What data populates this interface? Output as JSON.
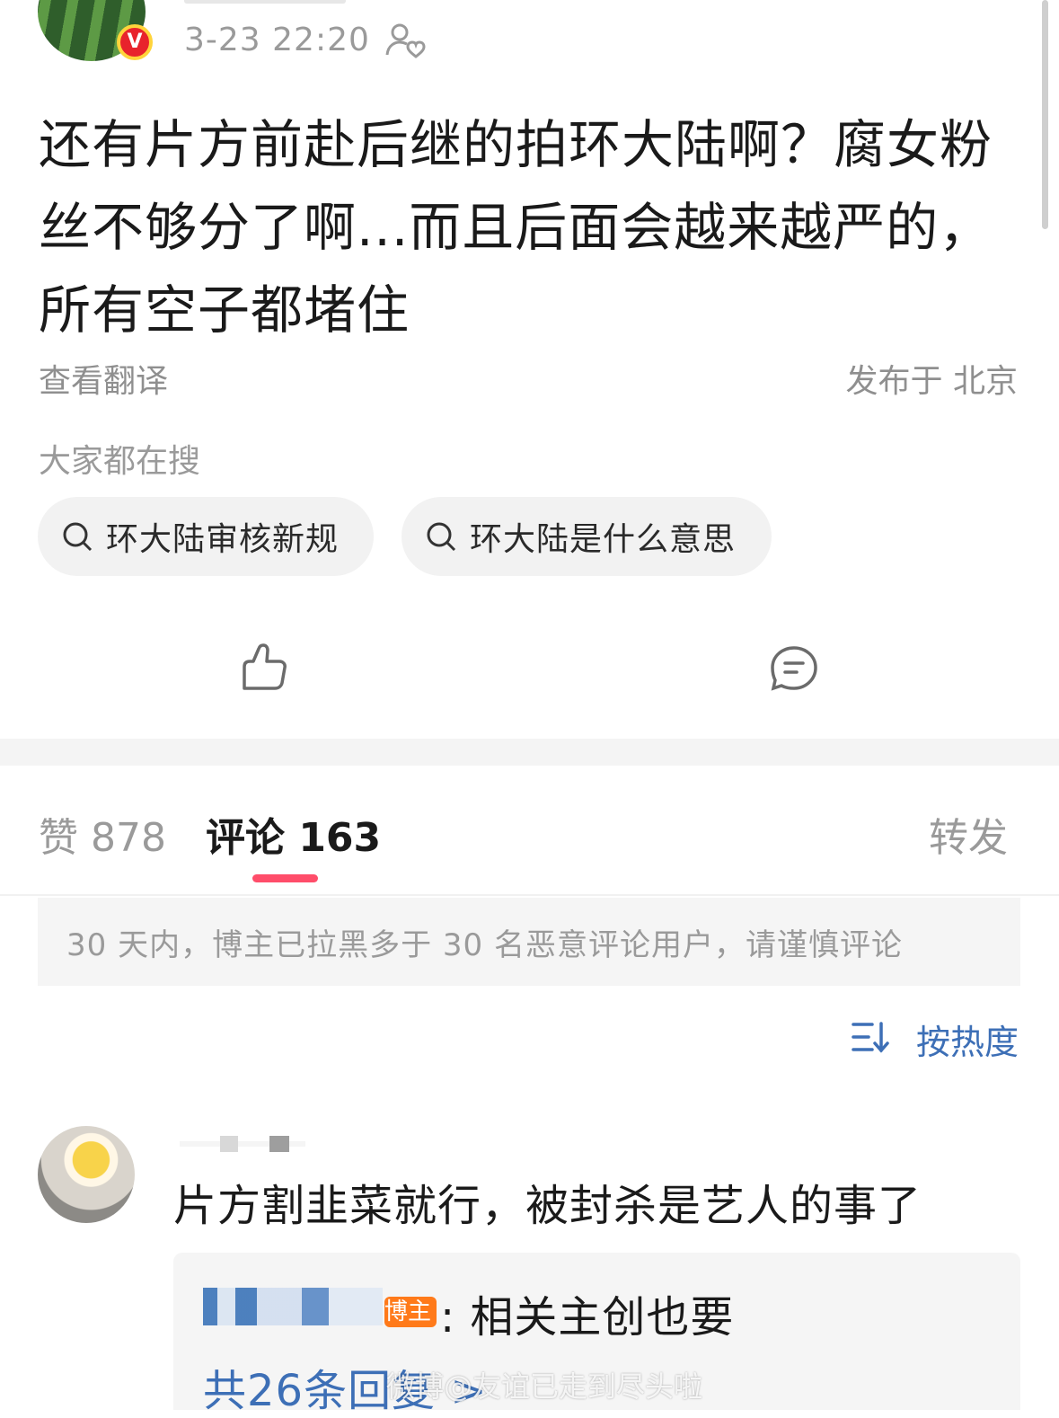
{
  "post": {
    "timestamp": "3-23 22:20",
    "verified_badge": "V",
    "text": "还有片方前赴后继的拍环大陆啊？腐女粉丝不够分了啊...而且后面会越来越严的，所有空子都堵住",
    "translate_label": "查看翻译",
    "location": "发布于 北京"
  },
  "trending": {
    "title": "大家都在搜",
    "chips": [
      {
        "label": "环大陆审核新规"
      },
      {
        "label": "环大陆是什么意思"
      }
    ]
  },
  "actions": {
    "like_icon": "thumbs-up-icon",
    "comment_icon": "comment-bubble-icon"
  },
  "tabs": {
    "like": "赞 878",
    "comment": "评论 163",
    "repost": "转发",
    "active": "comment",
    "active_color": "#ff4d6a"
  },
  "notice": {
    "text": "30 天内，博主已拉黑多于 30 名恶意评论用户，请谨慎评论"
  },
  "sort": {
    "label": "按热度",
    "color": "#3d6fb6"
  },
  "comments": [
    {
      "text": "片方割韭菜就行，被封杀是艺人的事了",
      "replies": [
        {
          "author_badge": "博主",
          "text": ": 相关主创也要"
        }
      ],
      "reply_count_label": "共26条回复 >"
    }
  ],
  "watermark": "微博@友谊已走到尽头啦"
}
